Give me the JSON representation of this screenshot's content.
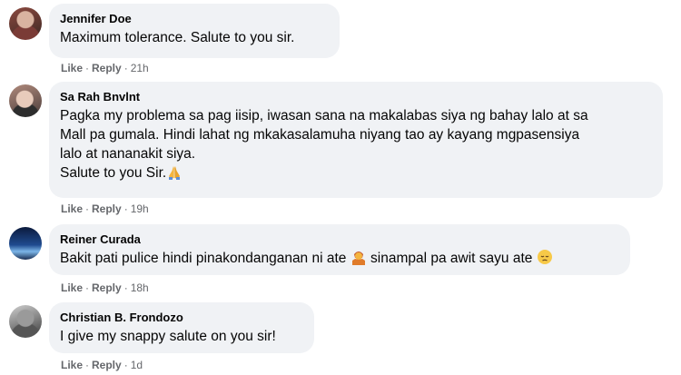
{
  "comments": [
    {
      "author": "Jennifer Doe",
      "text_lines": [
        "Maximum tolerance. Salute to you sir."
      ],
      "like_label": "Like",
      "reply_label": "Reply",
      "separator": "·",
      "time": "21h",
      "avatar_icon": "profile-photo"
    },
    {
      "author": "Sa Rah Bnvlnt",
      "text_lines": [
        "Pagka my problema sa pag iisip, iwasan sana na makalabas siya ng bahay lalo at sa",
        "Mall pa gumala. Hindi lahat ng mkakasalamuha niyang tao ay kayang mgpasensiya",
        "lalo at nananakit siya.",
        "Salute to you Sir."
      ],
      "emoji_after_last_line": "folded-hands-emoji",
      "like_label": "Like",
      "reply_label": "Reply",
      "separator": "·",
      "time": "19h",
      "avatar_icon": "profile-photo"
    },
    {
      "author": "Reiner Curada",
      "text_part1": "Bakit pati pulice hindi pinakondanganan ni ate",
      "emoji_mid": "person-shrugging-emoji",
      "text_part2": "sinampal pa awit sayu ate",
      "emoji_end": "pensive-face-emoji",
      "like_label": "Like",
      "reply_label": "Reply",
      "separator": "·",
      "time": "18h",
      "avatar_icon": "profile-photo"
    },
    {
      "author": "Christian B. Frondozo",
      "text_lines": [
        "I give my snappy salute on you sir!"
      ],
      "like_label": "Like",
      "reply_label": "Reply",
      "separator": "·",
      "time": "1d",
      "avatar_icon": "profile-photo"
    }
  ],
  "colors": {
    "bubble": "#f0f2f5",
    "meta_text": "#65676b",
    "body_text": "#050505"
  }
}
